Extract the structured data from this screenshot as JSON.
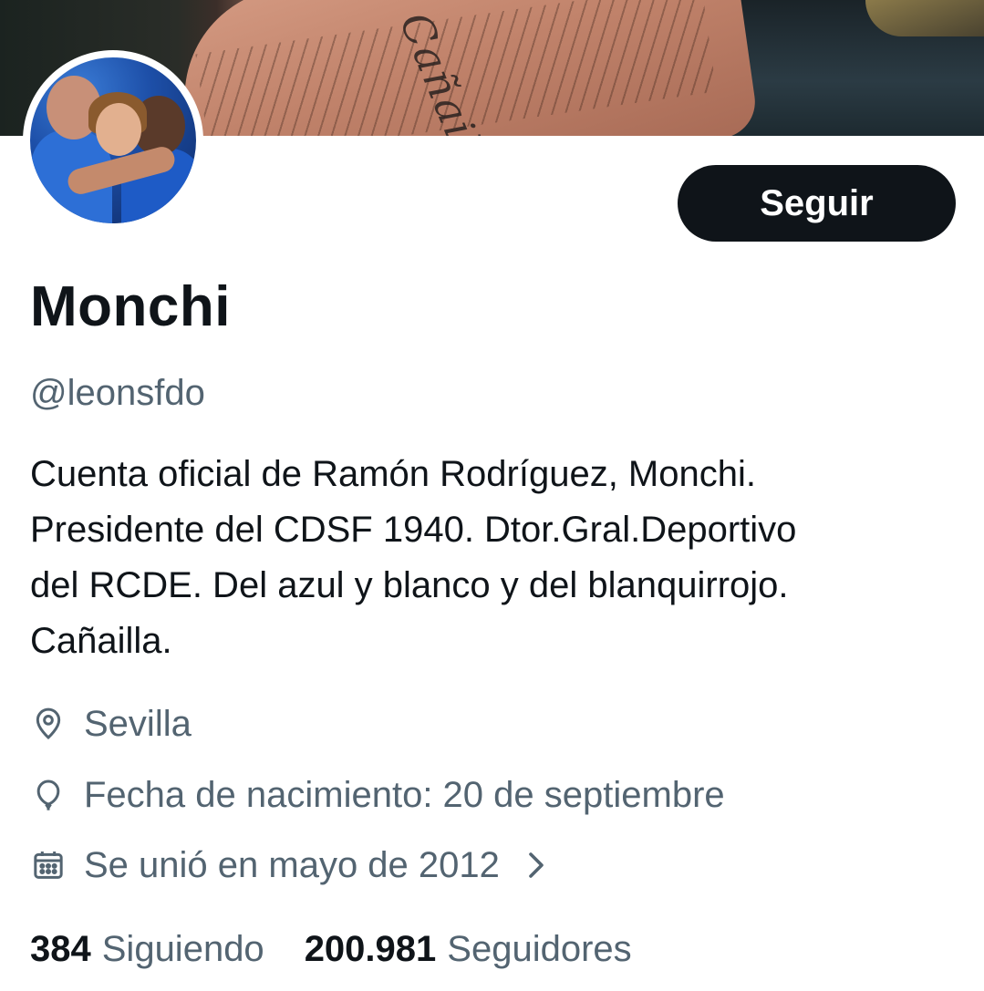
{
  "profile": {
    "name": "Monchi",
    "handle": "@leonsfdo",
    "follow_label": "Seguir",
    "banner_tattoo": "Cañailla",
    "bio_lines": [
      "Cuenta oficial de Ramón Rodríguez, Monchi.",
      "Presidente del CDSF 1940. Dtor.Gral.Deportivo",
      "del RCDE. Del azul y blanco y del blanquirrojo.",
      "Cañailla."
    ],
    "location": "Sevilla",
    "birth": "Fecha de nacimiento: 20 de septiembre",
    "joined": "Se unió en mayo de 2012",
    "following_count": "384",
    "following_label": "Siguiendo",
    "followers_count": "200.981",
    "followers_label": "Seguidores"
  },
  "icons": {
    "location": "location-pin-icon",
    "birth": "balloon-icon",
    "joined": "calendar-icon",
    "chevron": "chevron-right-icon"
  },
  "colors": {
    "text_primary": "#0f1419",
    "text_secondary": "#536471",
    "button_bg": "#0f1419",
    "button_text": "#ffffff"
  }
}
